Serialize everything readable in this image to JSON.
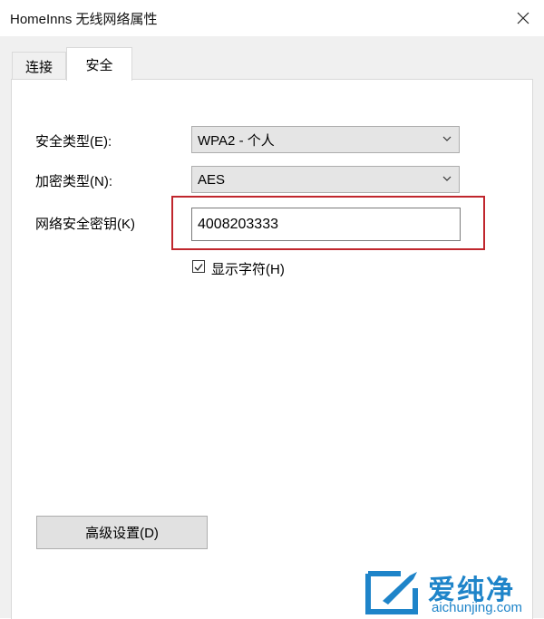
{
  "window": {
    "title": "HomeInns 无线网络属性"
  },
  "tabs": [
    {
      "label": "连接",
      "selected": false
    },
    {
      "label": "安全",
      "selected": true
    }
  ],
  "form": {
    "security_type": {
      "label": "安全类型(E):",
      "value": "WPA2 - 个人"
    },
    "encryption_type": {
      "label": "加密类型(N):",
      "value": "AES"
    },
    "network_key": {
      "label": "网络安全密钥(K)",
      "value": "4008203333"
    },
    "show_characters": {
      "label": "显示字符(H)",
      "checked": true
    }
  },
  "buttons": {
    "advanced": "高级设置(D)"
  },
  "watermark": {
    "name": "爱纯净",
    "url": "aichunjing.com"
  },
  "colors": {
    "highlight": "#c0262d",
    "watermark": "#1e84c9"
  }
}
